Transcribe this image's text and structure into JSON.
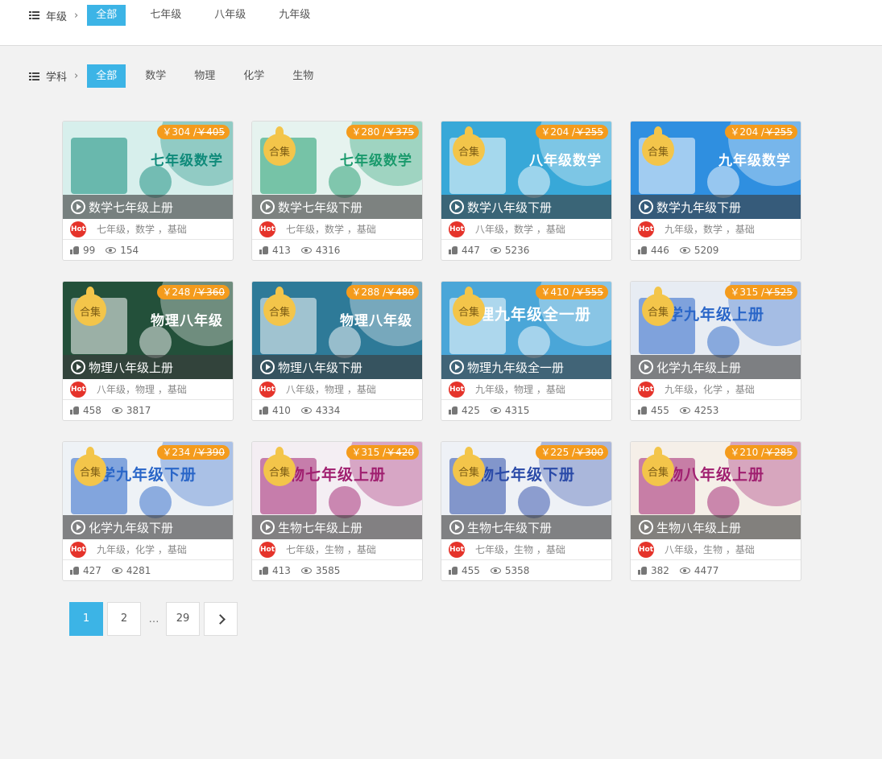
{
  "filters": {
    "grade": {
      "label": "年级",
      "options": [
        "全部",
        "七年级",
        "八年级",
        "九年级"
      ]
    },
    "subject": {
      "label": "学科",
      "options": [
        "全部",
        "数学",
        "物理",
        "化学",
        "生物"
      ]
    }
  },
  "badge_label": "合集",
  "hot_label": "Hot",
  "courses": [
    {
      "title": "数学七年级上册",
      "cover": "七年级数学",
      "price": "￥304 /",
      "original": "￥405",
      "tags": "七年级，数学 ，基础",
      "likes": "99",
      "views": "154",
      "bg": "#d7efec",
      "accent": "#0f8a7a"
    },
    {
      "title": "数学七年级下册",
      "cover": "七年级数学",
      "price": "￥280 /",
      "original": "￥375",
      "tags": "七年级，数学 ，基础",
      "likes": "413",
      "views": "4316",
      "bg": "#e6f3ef",
      "accent": "#1a9a6c"
    },
    {
      "title": "数学八年级下册",
      "cover": "八年级数学",
      "price": "￥204 /",
      "original": "￥255",
      "tags": "八年级，数学 ，基础",
      "likes": "447",
      "views": "5236",
      "bg": "#38a8d8",
      "accent": "#ffffff"
    },
    {
      "title": "数学九年级下册",
      "cover": "九年级数学",
      "price": "￥204 /",
      "original": "￥255",
      "tags": "九年级，数学 ，基础",
      "likes": "446",
      "views": "5209",
      "bg": "#2f8fe0",
      "accent": "#ffffff"
    },
    {
      "title": "物理八年级上册",
      "cover": "物理八年级",
      "price": "￥248 /",
      "original": "￥360",
      "tags": "八年级，物理 ，基础",
      "likes": "458",
      "views": "3817",
      "bg": "#23503a",
      "accent": "#ffffff"
    },
    {
      "title": "物理八年级下册",
      "cover": "物理八年级",
      "price": "￥288 /",
      "original": "￥480",
      "tags": "八年级，物理 ，基础",
      "likes": "410",
      "views": "4334",
      "bg": "#2e7a98",
      "accent": "#ffffff"
    },
    {
      "title": "物理九年级全一册",
      "cover": "物理九年级全一册",
      "price": "￥410 /",
      "original": "￥555",
      "tags": "九年级，物理 ，基础",
      "likes": "425",
      "views": "4315",
      "bg": "#4aa6d8",
      "accent": "#ffffff"
    },
    {
      "title": "化学九年级上册",
      "cover": "化学九年级上册",
      "price": "￥315 /",
      "original": "￥525",
      "tags": "九年级，化学 ，基础",
      "likes": "455",
      "views": "4253",
      "bg": "#e7ecf3",
      "accent": "#2a66c8"
    },
    {
      "title": "化学九年级下册",
      "cover": "化学九年级下册",
      "price": "￥234 /",
      "original": "￥390",
      "tags": "九年级，化学 ，基础",
      "likes": "427",
      "views": "4281",
      "bg": "#eef2f6",
      "accent": "#2a66c8"
    },
    {
      "title": "生物七年级上册",
      "cover": "生物七年级上册",
      "price": "￥315 /",
      "original": "￥420",
      "tags": "七年级，生物 ，基础",
      "likes": "413",
      "views": "3585",
      "bg": "#f4eef3",
      "accent": "#a02070"
    },
    {
      "title": "生物七年级下册",
      "cover": "生物七年级下册",
      "price": "￥225 /",
      "original": "￥300",
      "tags": "七年级，生物 ，基础",
      "likes": "455",
      "views": "5358",
      "bg": "#eef1f6",
      "accent": "#2a4aa8"
    },
    {
      "title": "生物八年级上册",
      "cover": "生物八年级上册",
      "price": "￥210 /",
      "original": "￥285",
      "tags": "八年级，生物 ，基础",
      "likes": "382",
      "views": "4477",
      "bg": "#f5efe8",
      "accent": "#a02070"
    }
  ],
  "pagination": {
    "pages": [
      "1",
      "2",
      "29"
    ],
    "ellipsis": "…",
    "current": "1"
  }
}
